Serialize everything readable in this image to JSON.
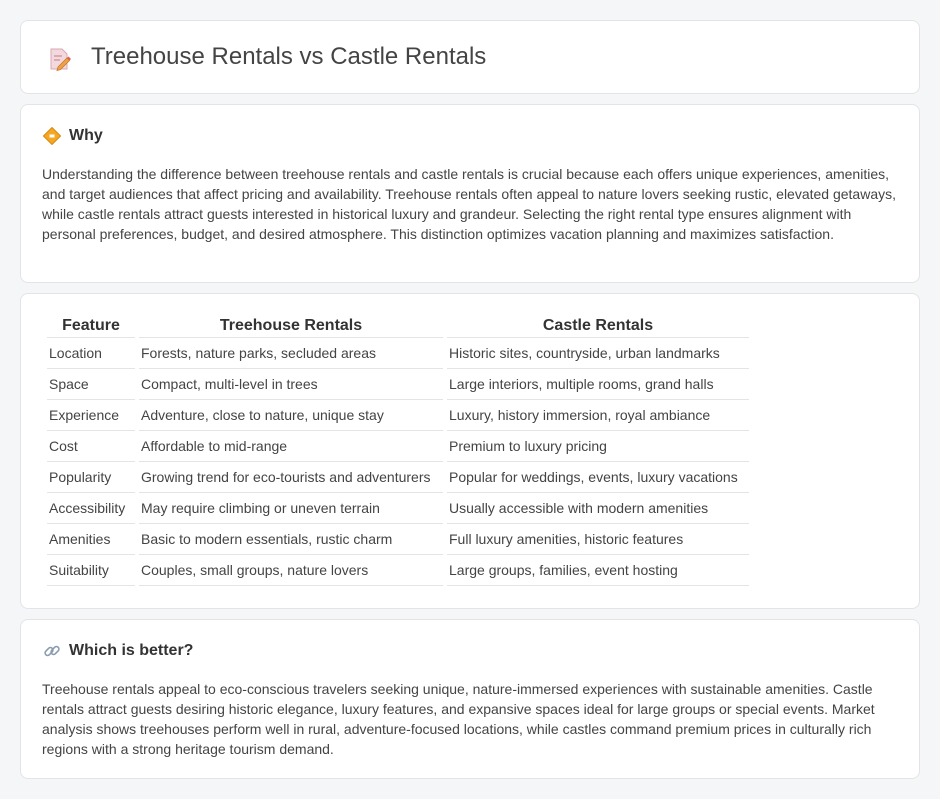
{
  "header": {
    "title": "Treehouse Rentals vs Castle Rentals",
    "icon": "document-pencil-icon"
  },
  "why": {
    "heading": "Why",
    "icon": "diamond-sign-icon",
    "text": "Understanding the difference between treehouse rentals and castle rentals is crucial because each offers unique experiences, amenities, and target audiences that affect pricing and availability. Treehouse rentals often appeal to nature lovers seeking rustic, elevated getaways, while castle rentals attract guests interested in historical luxury and grandeur. Selecting the right rental type ensures alignment with personal preferences, budget, and desired atmosphere. This distinction optimizes vacation planning and maximizes satisfaction."
  },
  "table": {
    "headers": [
      "Feature",
      "Treehouse Rentals",
      "Castle Rentals"
    ],
    "rows": [
      [
        "Location",
        "Forests, nature parks, secluded areas",
        "Historic sites, countryside, urban landmarks"
      ],
      [
        "Space",
        "Compact, multi-level in trees",
        "Large interiors, multiple rooms, grand halls"
      ],
      [
        "Experience",
        "Adventure, close to nature, unique stay",
        "Luxury, history immersion, royal ambiance"
      ],
      [
        "Cost",
        "Affordable to mid-range",
        "Premium to luxury pricing"
      ],
      [
        "Popularity",
        "Growing trend for eco-tourists and adventurers",
        "Popular for weddings, events, luxury vacations"
      ],
      [
        "Accessibility",
        "May require climbing or uneven terrain",
        "Usually accessible with modern amenities"
      ],
      [
        "Amenities",
        "Basic to modern essentials, rustic charm",
        "Full luxury amenities, historic features"
      ],
      [
        "Suitability",
        "Couples, small groups, nature lovers",
        "Large groups, families, event hosting"
      ]
    ]
  },
  "better": {
    "heading": "Which is better?",
    "icon": "link-icon",
    "text": "Treehouse rentals appeal to eco-conscious travelers seeking unique, nature-immersed experiences with sustainable amenities. Castle rentals attract guests desiring historic elegance, luxury features, and expansive spaces ideal for large groups or special events. Market analysis shows treehouses perform well in rural, adventure-focused locations, while castles command premium prices in culturally rich regions with a strong heritage tourism demand."
  }
}
